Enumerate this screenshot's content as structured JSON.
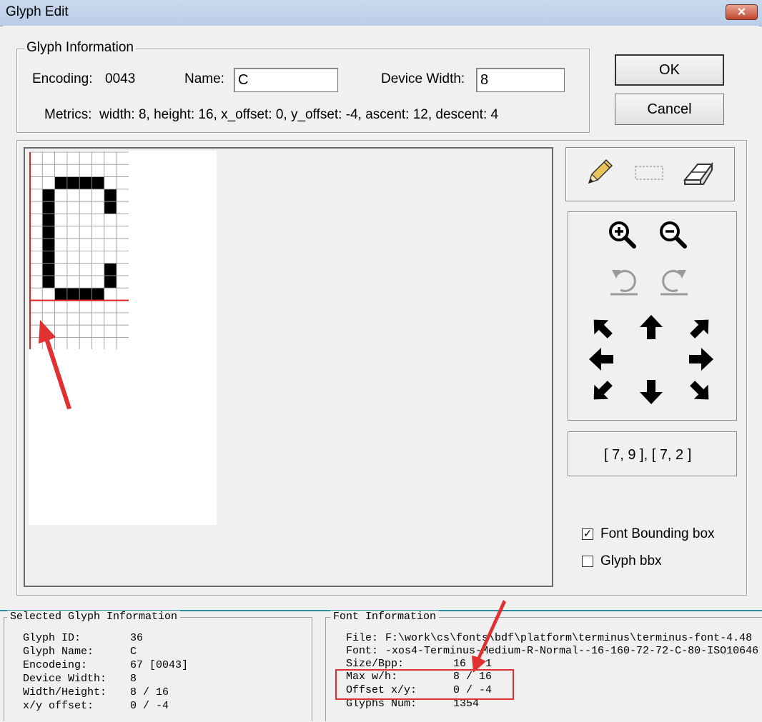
{
  "window": {
    "title": "Glyph Edit",
    "close_glyph": "✕"
  },
  "glyph_information": {
    "legend": "Glyph Information",
    "encoding_label": "Encoding:",
    "encoding_value": "0043",
    "name_label": "Name:",
    "name_value": "C",
    "device_width_label": "Device Width:",
    "device_width_value": "8",
    "metrics": "Metrics:  width: 8, height: 16, x_offset: 0, y_offset: -4, ascent: 12, descent: 4"
  },
  "buttons": {
    "ok": "OK",
    "cancel": "Cancel"
  },
  "glyph_bitmap": {
    "cols": 8,
    "rows": 16,
    "baseline_row": 12,
    "on_color": "#000000",
    "grid_color": "#9a9a9a",
    "axis_color": "#e02020",
    "pixels": [
      "00000000",
      "00000000",
      "00111100",
      "01000010",
      "01000010",
      "01000000",
      "01000000",
      "01000000",
      "01000000",
      "01000010",
      "01000010",
      "00111100",
      "00000000",
      "00000000",
      "00000000",
      "00000000"
    ]
  },
  "tools": {
    "pencil": "pencil-icon",
    "select": "rectangle-select-icon",
    "eraser": "eraser-icon"
  },
  "view_controls": {
    "zoom_in": "zoom-in-icon",
    "zoom_out": "zoom-out-icon",
    "undo": "undo-icon",
    "redo": "redo-icon"
  },
  "coordinates": "[ 7, 9 ], [ 7, 2 ]",
  "options": {
    "font_bounding_box": {
      "label": "Font Bounding box",
      "checked": true,
      "mark": "✓"
    },
    "glyph_bbx": {
      "label": "Glyph bbx",
      "checked": false,
      "mark": ""
    }
  },
  "selected_glyph": {
    "legend": "Selected Glyph Information",
    "rows": [
      {
        "label": "Glyph ID:",
        "value": "36"
      },
      {
        "label": "Glyph Name:",
        "value": "C"
      },
      {
        "label": "Encodeing:",
        "value": "67 [0043]"
      },
      {
        "label": "Device Width:",
        "value": "8"
      },
      {
        "label": "Width/Height:",
        "value": "8 / 16"
      },
      {
        "label": "x/y offset:",
        "value": "0 / -4"
      }
    ]
  },
  "font_information": {
    "legend": "Font Information",
    "file_label": "File:",
    "file_value": "F:\\work\\cs\\fonts\\bdf\\platform\\terminus\\terminus-font-4.48",
    "font_label": "Font:",
    "font_value": "-xos4-Terminus-Medium-R-Normal--16-160-72-72-C-80-ISO10646",
    "size_label": "Size/Bpp:",
    "size_value": "16 / 1",
    "max_label": "Max w/h:",
    "max_value": "8 / 16",
    "offset_label": "Offset x/y:",
    "offset_value": "0 / -4",
    "glyphs_label": "Glyphs Num:",
    "glyphs_value": "1354"
  },
  "annotation_color": "#e03030"
}
